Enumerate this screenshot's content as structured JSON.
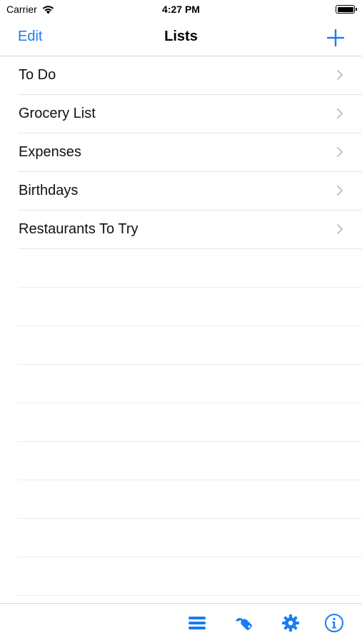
{
  "status_bar": {
    "carrier": "Carrier",
    "time": "4:27 PM"
  },
  "nav": {
    "edit_label": "Edit",
    "title": "Lists",
    "add_icon": "plus-icon"
  },
  "lists": [
    {
      "label": "To Do"
    },
    {
      "label": "Grocery List"
    },
    {
      "label": "Expenses"
    },
    {
      "label": "Birthdays"
    },
    {
      "label": "Restaurants To Try"
    }
  ],
  "toolbar": {
    "icons": [
      "list-icon",
      "wrench-icon",
      "gear-icon",
      "info-icon"
    ]
  },
  "colors": {
    "accent": "#1a7cf0",
    "separator": "#e4e4e4",
    "chevron": "#c4c4c7"
  }
}
